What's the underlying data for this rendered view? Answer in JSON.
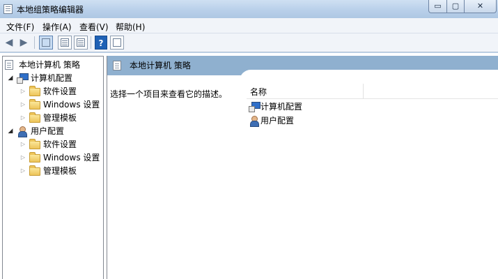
{
  "window": {
    "title": "本地组策略编辑器",
    "buttons": {
      "minimize": "▭",
      "maximize": "▢",
      "close": "✕"
    }
  },
  "menu": [
    {
      "label": "文件(F)"
    },
    {
      "label": "操作(A)"
    },
    {
      "label": "查看(V)"
    },
    {
      "label": "帮助(H)"
    }
  ],
  "toolbar": {
    "back_icon": "arrow-left-icon",
    "forward_icon": "arrow-right-icon",
    "help_label": "?"
  },
  "tree": {
    "root": "本地计算机 策略",
    "computer_config": "计算机配置",
    "user_config": "用户配置",
    "computer_children": [
      "软件设置",
      "Windows 设置",
      "管理模板"
    ],
    "user_children": [
      "软件设置",
      "Windows 设置",
      "管理模板"
    ]
  },
  "details": {
    "header": "本地计算机 策略",
    "description": "选择一个项目来查看它的描述。",
    "column_name": "名称",
    "items": [
      "计算机配置",
      "用户配置"
    ]
  }
}
